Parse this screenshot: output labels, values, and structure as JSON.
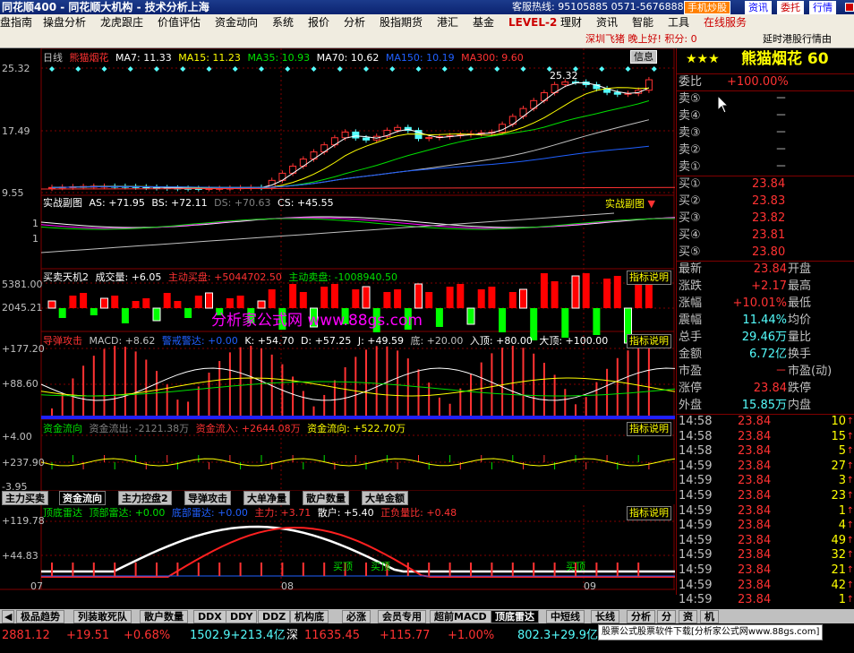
{
  "titlebar": {
    "title": "同花顺400 - 同花顺大机构 - 技术分析上海",
    "hotline": "客服热线: 95105885  0571-56768888",
    "btn_mobile": "手机炒股",
    "btn_info": "资讯",
    "btn_trade": "委托",
    "btn_quote": "行情"
  },
  "menu": [
    "盘指南",
    "操盘分析",
    "龙虎跟庄",
    "价值评估",
    "资金动向",
    "系统",
    "报价",
    "分析",
    "股指期货",
    "港汇",
    "基金",
    "LEVEL-2",
    "理财",
    "资讯",
    "智能",
    "工具",
    "在线服务"
  ],
  "infobar": {
    "greeting": "深圳飞猪  晚上好! 积分: 0",
    "news": "延时港股行情由"
  },
  "main_chart": {
    "period_label": "日线",
    "stock": "熊猫烟花",
    "ma7": "MA7: 11.33",
    "ma15": "MA15: 11.23",
    "ma35": "MA35: 10.93",
    "ma70": "MA70: 10.62",
    "ma150": "MA150: 10.19",
    "ma300": "MA300: 9.60",
    "info_btn": "信息",
    "y_top": "25.32",
    "y_mid": "17.49",
    "y_bot": "9.55",
    "peak": "25.32"
  },
  "panel1": {
    "title": "实战副图",
    "as": "AS: +71.95",
    "bs": "BS: +72.11",
    "ds": "DS: +70.63",
    "cs": "CS: +45.55",
    "btn": "实战副图",
    "y1": "1",
    "y2": "1"
  },
  "panel2": {
    "title": "买卖天机2",
    "vol": "成交量: +6.05",
    "buy": "主动买盘: +5044702.50",
    "sell": "主动卖盘: -1008940.50",
    "btn": "指标说明",
    "y1": "5381.00",
    "y2": "2045.21",
    "watermark": "分析家公式网 www.88gs.com"
  },
  "panel3": {
    "title": "导弹攻击",
    "macd": "MACD: +8.62",
    "warn": "警戒警达: +0.00",
    "k": "K: +54.70",
    "d": "D: +57.25",
    "j": "J: +49.59",
    "bottom": "底: +20.00",
    "enter": "入顶: +80.00",
    "top": "大顶: +100.00",
    "btn": "指标说明",
    "y1": "+177.20",
    "y2": "+88.60"
  },
  "panel4": {
    "title": "资金流向",
    "out": "资金流出: -2121.38万",
    "in": "资金流入: +2644.08万",
    "flow": "资金流向: +522.70万",
    "btn": "指标说明",
    "y1": "+4.00",
    "y2": "+237.90",
    "y3": "-3.95"
  },
  "tabs1": [
    "主力买卖",
    "资金流向",
    "主力控盘2",
    "导弹攻击",
    "大单净量",
    "散户数量",
    "大单金额"
  ],
  "panel5": {
    "title": "顶底雷达",
    "top": "顶部雷达: +0.00",
    "bottom": "底部雷达: +0.00",
    "main": "主力: +3.71",
    "retail": "散户: +5.40",
    "neg": "正负量比: +0.48",
    "btn": "指标说明",
    "y1": "+119.78",
    "y2": "+44.83",
    "t1": "买顶",
    "t2": "买顶",
    "t3": "买顶"
  },
  "xaxis": {
    "m1": "07",
    "m2": "08",
    "m3": "09"
  },
  "right": {
    "stars": "★★★",
    "name": "熊猫烟花 60",
    "weibi": {
      "label": "委比",
      "value": "+100.00%"
    },
    "asks": [
      {
        "label": "卖⑤",
        "value": "－"
      },
      {
        "label": "卖④",
        "value": "－"
      },
      {
        "label": "卖③",
        "value": "－"
      },
      {
        "label": "卖②",
        "value": "－"
      },
      {
        "label": "卖①",
        "value": "－"
      }
    ],
    "bids": [
      {
        "label": "买①",
        "value": "23.84"
      },
      {
        "label": "买②",
        "value": "23.83"
      },
      {
        "label": "买③",
        "value": "23.82"
      },
      {
        "label": "买④",
        "value": "23.81"
      },
      {
        "label": "买⑤",
        "value": "23.80"
      }
    ],
    "stats": [
      {
        "l": "最新",
        "v": "23.84",
        "l2": "开盘",
        "v2": ""
      },
      {
        "l": "涨跌",
        "v": "+2.17",
        "l2": "最高",
        "v2": ""
      },
      {
        "l": "涨幅",
        "v": "+10.01%",
        "l2": "最低",
        "v2": ""
      },
      {
        "l": "震幅",
        "v": "11.44%",
        "l2": "均价",
        "v2": ""
      },
      {
        "l": "总手",
        "v": "29.46万",
        "l2": "量比",
        "v2": ""
      },
      {
        "l": "金额",
        "v": "6.72亿",
        "l2": "换手",
        "v2": ""
      },
      {
        "l": "市盈",
        "v": "－",
        "l2": "市盈(动)",
        "v2": ""
      },
      {
        "l": "涨停",
        "v": "23.84",
        "l2": "跌停",
        "v2": ""
      },
      {
        "l": "外盘",
        "v": "15.85万",
        "l2": "内盘",
        "v2": ""
      }
    ],
    "ticks": [
      {
        "t": "14:58",
        "p": "23.84",
        "v": "10"
      },
      {
        "t": "14:58",
        "p": "23.84",
        "v": "15"
      },
      {
        "t": "14:58",
        "p": "23.84",
        "v": "5"
      },
      {
        "t": "14:59",
        "p": "23.84",
        "v": "27"
      },
      {
        "t": "14:59",
        "p": "23.84",
        "v": "3"
      },
      {
        "t": "14:59",
        "p": "23.84",
        "v": "23"
      },
      {
        "t": "14:59",
        "p": "23.84",
        "v": "1"
      },
      {
        "t": "14:59",
        "p": "23.84",
        "v": "4"
      },
      {
        "t": "14:59",
        "p": "23.84",
        "v": "49"
      },
      {
        "t": "14:59",
        "p": "23.84",
        "v": "32"
      },
      {
        "t": "14:59",
        "p": "23.84",
        "v": "21"
      },
      {
        "t": "14:59",
        "p": "23.84",
        "v": "42"
      },
      {
        "t": "14:59",
        "p": "23.84",
        "v": "1"
      }
    ]
  },
  "tabs2": [
    "极品趋势",
    "列装敢死队",
    "散户数量",
    "DDX",
    "DDY",
    "DDZ",
    "机构底",
    "必涨",
    "会员专用",
    "超前MACD",
    "顶底雷达",
    "中短线",
    "长线",
    "分析",
    "分",
    "资",
    "机"
  ],
  "status": {
    "sh": "2881.12",
    "sh_chg": "+19.51",
    "sh_pct": "+0.68%",
    "sh_vol": "1502.9+213.4亿",
    "sz_label": "深",
    "sz": "11635.45",
    "sz_chg": "+115.77",
    "sz_pct": "+1.00%",
    "sz_vol": "802.3+29.9亿",
    "ad": "股票公式股票软件下载[分析家公式网www.88gs.com]"
  },
  "colors": {
    "up": "#ff3232",
    "down": "#54fcfc",
    "yellow": "#ffff00",
    "green": "#00e000",
    "magenta": "#ff00ff",
    "white": "#ffffff"
  }
}
